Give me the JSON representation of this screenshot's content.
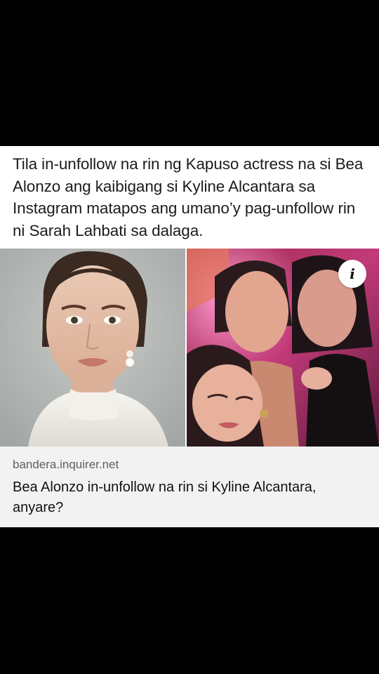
{
  "post": {
    "caption": "Tila in-unfollow na rin ng Kapuso actress na si Bea Alonzo ang kaibigang si Kyline Alcantara sa Instagram matapos ang umano’y pag-unfollow rin ni Sarah Lahbati sa dalaga."
  },
  "link_preview": {
    "domain": "bandera.inquirer.net",
    "headline": "Bea Alonzo in-unfollow na rin si Kyline Alcantara, anyare?",
    "info_icon": "info-icon",
    "info_glyph": "i"
  },
  "images": {
    "left": "portrait-photo",
    "right": "group-selfie-photo"
  }
}
